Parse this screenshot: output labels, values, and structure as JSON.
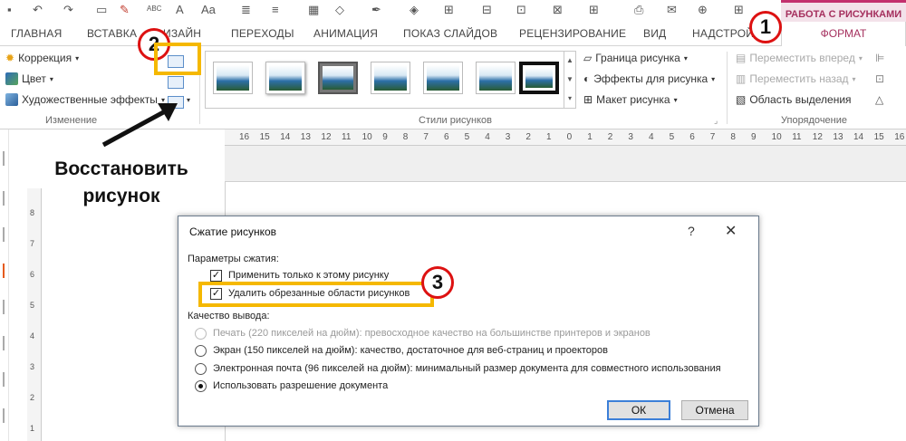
{
  "quick_access": {
    "icons": [
      "save-icon",
      "undo-icon",
      "redo-icon",
      "format-painter-icon",
      "spelling-icon"
    ],
    "spell_label": "ABC",
    "font_size_label": "Aa",
    "font_a_label": "A"
  },
  "context_group": {
    "title": "РАБОТА С РИСУНКАМИ"
  },
  "tabs": [
    {
      "label": "ГЛАВНАЯ"
    },
    {
      "label": "ВСТАВКА"
    },
    {
      "label": "ИЗАЙН"
    },
    {
      "label": "ПЕРЕХОДЫ"
    },
    {
      "label": "АНИМАЦИЯ"
    },
    {
      "label": "ПОКАЗ СЛАЙДОВ"
    },
    {
      "label": "РЕЦЕНЗИРОВАНИЕ"
    },
    {
      "label": "ВИД"
    },
    {
      "label": "НАДСТРОЙ"
    }
  ],
  "active_tab": {
    "label": "ФОРМАТ"
  },
  "ribbon": {
    "adjust_group": {
      "correction": "Коррекция",
      "color": "Цвет",
      "artistic": "Художественные эффекты",
      "label": "Изменение"
    },
    "styles_group": {
      "border": "Граница рисунка",
      "effects": "Эффекты для рисунка",
      "layout": "Макет рисунка",
      "label": "Стили рисунков",
      "thumb_count": 7
    },
    "arrange_group": {
      "bring_forward": "Переместить вперед",
      "send_backward": "Переместить назад",
      "selection_pane": "Область выделения",
      "label": "Упорядочение"
    }
  },
  "ruler": {
    "top_labels": [
      "16",
      "15",
      "14",
      "13",
      "12",
      "11",
      "10",
      "9",
      "8",
      "7",
      "6",
      "5",
      "4",
      "3",
      "2",
      "1",
      "0",
      "1",
      "2",
      "3",
      "4",
      "5",
      "6",
      "7",
      "8",
      "9",
      "10",
      "11",
      "12",
      "13",
      "14",
      "15",
      "16"
    ],
    "left_labels": [
      "8",
      "7",
      "6",
      "5",
      "4",
      "3",
      "2",
      "1"
    ]
  },
  "annotations": {
    "restore_line1": "Восстановить",
    "restore_line2": "рисунок",
    "marker_1": "1",
    "marker_2": "2",
    "marker_3": "3"
  },
  "dialog": {
    "title": "Сжатие рисунков",
    "help": "?",
    "close": "✕",
    "compression_options_label": "Параметры сжатия:",
    "apply_only_this": {
      "label": "Применить только к этому рисунку",
      "checked": true
    },
    "delete_cropped": {
      "label": "Удалить обрезанные области рисунков",
      "checked": true
    },
    "output_quality_label": "Качество вывода:",
    "options": [
      {
        "label": "Печать (220 пикселей на дюйм): превосходное качество на большинстве принтеров и экранов",
        "enabled": false,
        "checked": false
      },
      {
        "label": "Экран (150 пикселей на дюйм): качество, достаточное для веб-страниц и проекторов",
        "enabled": true,
        "checked": false
      },
      {
        "label": "Электронная почта (96 пикселей на дюйм): минимальный размер документа для совместного использования",
        "enabled": true,
        "checked": false
      },
      {
        "label": "Использовать разрешение документа",
        "enabled": true,
        "checked": true
      }
    ],
    "ok": "ОК",
    "cancel": "Отмена"
  }
}
